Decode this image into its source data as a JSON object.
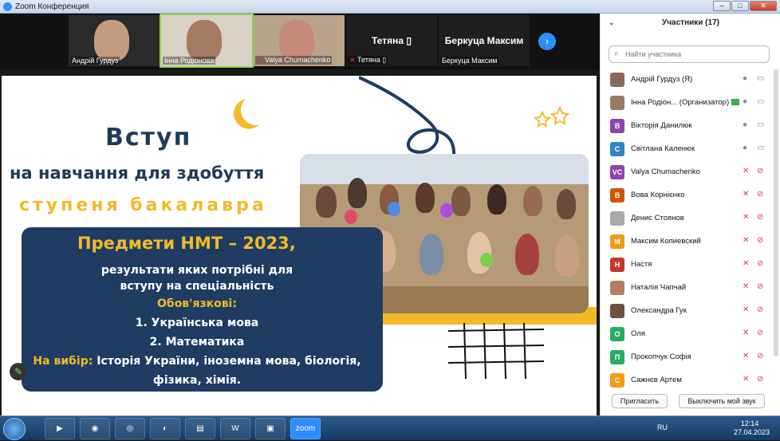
{
  "window": {
    "title": "Zoom Конференция"
  },
  "video_strip": {
    "tiles": [
      {
        "name": "Андрій Гурдуз",
        "muted": false
      },
      {
        "name": "Інна Родіонова",
        "muted": false
      },
      {
        "name": "Valya Chumachenko",
        "muted": true
      },
      {
        "name": "Тетяна ▯",
        "muted": true,
        "header": "Тетяна ▯"
      },
      {
        "name": "Беркуца Максим",
        "muted": false,
        "header": "Беркуца Максим"
      }
    ]
  },
  "slide": {
    "title_line1": "Вступ",
    "title_line2": "на навчання для здобуття",
    "title_line3": "ступеня бакалавра",
    "box_heading": "Предмети НМТ – 2023,",
    "box_line1": "результати яких потрібні для",
    "box_line2": "вступу на спеціальність",
    "mandatory_label": "Обов'язкові:",
    "mandatory_1": "1. Українська мова",
    "mandatory_2": "2. Математика",
    "choice_label": "На вибір:",
    "choice_text": " Історія України, іноземна мова, біологія,",
    "choice_text2": "фізика, хімія."
  },
  "participants": {
    "header": "Участники (17)",
    "search_placeholder": "Найти участника",
    "list": [
      {
        "initials": "",
        "name": "Андрій Гурдуз (Я)",
        "color": "#8a6a55",
        "mic_off": false,
        "cam_off": false
      },
      {
        "initials": "",
        "name": "Інна Родіон... (Организатор)",
        "color": "#9a7a66",
        "mic_off": false,
        "cam_off": false,
        "badge": true
      },
      {
        "initials": "В",
        "name": "Вікторія Данилюк",
        "color": "#8e44ad",
        "mic_off": false,
        "cam_off": false
      },
      {
        "initials": "С",
        "name": "Світлана Каленюк",
        "color": "#2e86c1",
        "mic_off": false,
        "cam_off": false
      },
      {
        "initials": "VC",
        "name": "Valya Chumachenko",
        "color": "#8e44ad",
        "mic_off": true,
        "cam_off": true
      },
      {
        "initials": "В",
        "name": "Вова Корнієнко",
        "color": "#d35400",
        "mic_off": true,
        "cam_off": true
      },
      {
        "initials": "",
        "name": "Денис Стоянов",
        "color": "#aaaaaa",
        "mic_off": true,
        "cam_off": true
      },
      {
        "initials": "М",
        "name": "Максим Копиевский",
        "color": "#f39c12",
        "mic_off": true,
        "cam_off": true
      },
      {
        "initials": "Н",
        "name": "Настя",
        "color": "#c0392b",
        "mic_off": true,
        "cam_off": true
      },
      {
        "initials": "",
        "name": "Наталія Чапчай",
        "color": "#b08060",
        "mic_off": true,
        "cam_off": true
      },
      {
        "initials": "",
        "name": "Олександра Гук",
        "color": "#705040",
        "mic_off": true,
        "cam_off": true
      },
      {
        "initials": "О",
        "name": "Оля",
        "color": "#27ae60",
        "mic_off": true,
        "cam_off": true
      },
      {
        "initials": "П",
        "name": "Прокопчук Софія",
        "color": "#27ae60",
        "mic_off": true,
        "cam_off": true
      },
      {
        "initials": "С",
        "name": "Сажнєв Артем",
        "color": "#f39c12",
        "mic_off": true,
        "cam_off": true
      }
    ],
    "invite_label": "Пригласить",
    "mute_self_label": "Выключить мой звук"
  },
  "taskbar": {
    "lang": "RU",
    "time": "12:14",
    "date": "27.04.2023",
    "zoom_label": "zoom"
  }
}
